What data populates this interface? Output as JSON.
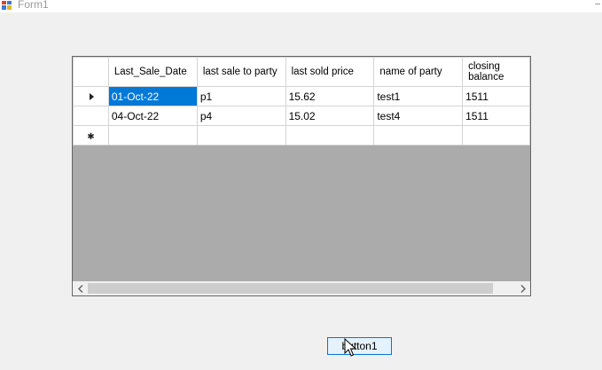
{
  "window": {
    "title": "Form1"
  },
  "grid": {
    "columns": [
      "Last_Sale_Date",
      "last sale to party",
      "last sold price",
      "name of party",
      "closing balance"
    ],
    "rows": [
      [
        "01-Oct-22",
        "p1",
        "15.62",
        "test1",
        "1511"
      ],
      [
        "04-Oct-22",
        "p4",
        "15.02",
        "test4",
        "1511"
      ]
    ],
    "selection_color": "#0078d7"
  },
  "button": {
    "label": "button1"
  }
}
